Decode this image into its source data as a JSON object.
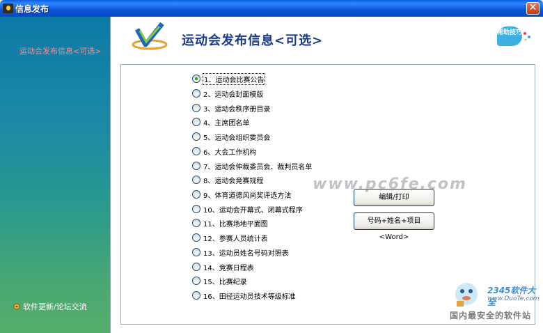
{
  "window": {
    "title": "信息发布",
    "close_glyph": "✕"
  },
  "sidebar": {
    "items": [
      {
        "label": "运动会发布信息<可选>",
        "color": "#ff8a8a"
      }
    ],
    "footer_label": "软件更新/论坛交流"
  },
  "header": {
    "title": "运动会发布信息<可选>",
    "help_label": "帮助技巧"
  },
  "options": [
    "1、运动会比赛公告",
    "2、运动会封面模版",
    "3、运动会秩序册目录",
    "4、主席团名单",
    "5、运动会组织委员会",
    "6、大会工作机构",
    "7、运动会仲裁委员会、裁判员名单",
    "8、运动会竞赛规程",
    "9、体育道德风尚奖评选方法",
    "10、运动会开幕式、闭幕式程序",
    "11、比赛场地平面图",
    "12、参赛人员统计表",
    "13、运动员姓名号码对照表",
    "14、竞赛日程表",
    "15、比赛纪录",
    "16、田径运动员技术等级标准"
  ],
  "selected_index": 0,
  "buttons": {
    "edit_print": "编辑/打印",
    "export_word": "号码+姓名+项目<Word>"
  },
  "watermark": "www.pc6fe.com",
  "corner": {
    "brand": "2345软件大全",
    "url": "www.DuoTe.com",
    "tagline": "国内最安全的软件站"
  },
  "colors": {
    "titlebar": "#0a55d8",
    "sidebar_top": "#0c7aa6",
    "sidebar_bottom": "#54ad6a",
    "title_text": "#1a3a8a"
  }
}
